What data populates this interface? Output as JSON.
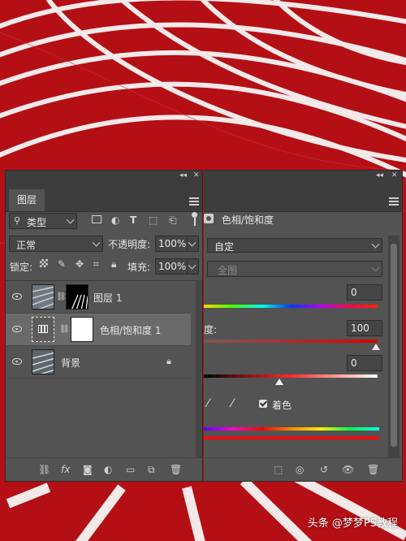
{
  "layers_panel": {
    "tab_label": "图层",
    "filter_label": "类型",
    "blend_mode": "正常",
    "opacity_label": "不透明度:",
    "opacity_value": "100%",
    "lock_label": "锁定:",
    "fill_label": "填充:",
    "fill_value": "100%",
    "layers": [
      {
        "name": "图层 1",
        "type": "pixel-with-mask"
      },
      {
        "name": "色相/饱和度 1",
        "type": "adjustment",
        "selected": true
      },
      {
        "name": "背景",
        "type": "background",
        "locked": true
      }
    ]
  },
  "properties_panel": {
    "title": "色相/饱和度",
    "preset_value": "自定",
    "channel_value": "全图",
    "hue_value": "0",
    "saturation_label": "度:",
    "saturation_value": "100",
    "lightness_value": "0",
    "colorize_label": "着色",
    "colorize_checked": true,
    "hue_slider_position": 0.5,
    "saturation_slider_position": 1.0,
    "lightness_slider_position": 0.5
  },
  "watermark": "头条 @梦梦PS教程",
  "colors": {
    "background_red": "#b00d12",
    "panel": "#535353",
    "panel_dark": "#3d3d3d"
  }
}
